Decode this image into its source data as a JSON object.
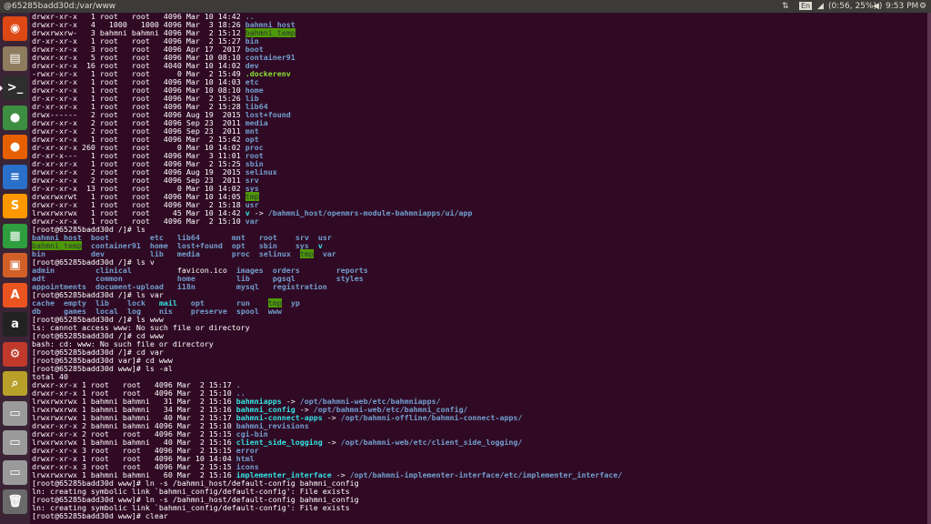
{
  "topbar": {
    "title": "@65285badd30d:/var/www",
    "kb": "En",
    "battery": "(0:56, 25%)",
    "time": "9:53 PM"
  },
  "launcher": [
    {
      "name": "ubuntu-dash-icon",
      "label": "◉",
      "color": "#dd4814"
    },
    {
      "name": "files-icon",
      "label": "▤",
      "color": "#8f7b5e"
    },
    {
      "name": "terminal-icon",
      "label": ">_",
      "color": "#2e2e2e",
      "active": true
    },
    {
      "name": "chrome-icon",
      "label": "●",
      "color": "#3e8e41"
    },
    {
      "name": "firefox-icon",
      "label": "●",
      "color": "#e66000"
    },
    {
      "name": "writer-icon",
      "label": "≡",
      "color": "#2a6fc9"
    },
    {
      "name": "sublime-icon",
      "label": "S",
      "color": "#ff9800"
    },
    {
      "name": "calc-icon",
      "label": "▦",
      "color": "#2e9e3e"
    },
    {
      "name": "impress-icon",
      "label": "▣",
      "color": "#d35f28"
    },
    {
      "name": "software-center-icon",
      "label": "A",
      "color": "#e95420"
    },
    {
      "name": "amazon-icon",
      "label": "a",
      "color": "#222222"
    },
    {
      "name": "settings-icon",
      "label": "⚙",
      "color": "#c0392b"
    },
    {
      "name": "image-viewer-icon",
      "label": "⌕",
      "color": "#b8a02a"
    },
    {
      "name": "drive-1-icon",
      "label": "▭",
      "color": "#9a9a9a"
    },
    {
      "name": "drive-2-icon",
      "label": "▭",
      "color": "#9a9a9a"
    },
    {
      "name": "drive-3-icon",
      "label": "▭",
      "color": "#9a9a9a"
    },
    {
      "name": "trash-icon",
      "label": "🗑",
      "color": "#6a6a6a"
    }
  ],
  "colors": {
    "terminal_bg": "#300a24",
    "dir": "#729fcf",
    "link": "#34e2e2",
    "exec": "#8ae234",
    "sticky_bg": "#4e9a06"
  },
  "lines": [
    [
      [
        "drwxr-xr-x   1 root   root   4096 Mar 10 14:42 "
      ],
      [
        "..",
        "d"
      ]
    ],
    [
      [
        "drwxr-xr-x   4   1000   1000 4096 Mar  3 18:26 "
      ],
      [
        "bahmni_host",
        "d"
      ]
    ],
    [
      [
        "drwxrwxrw-   3 bahmni bahmni 4096 Mar  2 15:12 "
      ],
      [
        "bahmni_temp",
        "hl"
      ]
    ],
    [
      [
        "dr-xr-xr-x   1 root   root   4096 Mar  2 15:27 "
      ],
      [
        "bin",
        "d"
      ]
    ],
    [
      [
        "drwxr-xr-x   3 root   root   4096 Apr 17  2017 "
      ],
      [
        "boot",
        "d"
      ]
    ],
    [
      [
        "drwxr-xr-x   5 root   root   4096 Mar 10 08:10 "
      ],
      [
        "container91",
        "d"
      ]
    ],
    [
      [
        "drwxr-xr-x  16 root   root   4040 Mar 10 14:02 "
      ],
      [
        "dev",
        "d"
      ]
    ],
    [
      [
        "-rwxr-xr-x   1 root   root      0 Mar  2 15:49 "
      ],
      [
        ".dockerenv",
        "g"
      ]
    ],
    [
      [
        "drwxr-xr-x   1 root   root   4096 Mar 10 14:03 "
      ],
      [
        "etc",
        "d"
      ]
    ],
    [
      [
        "drwxr-xr-x   1 root   root   4096 Mar 10 08:10 "
      ],
      [
        "home",
        "d"
      ]
    ],
    [
      [
        "dr-xr-xr-x   1 root   root   4096 Mar  2 15:26 "
      ],
      [
        "lib",
        "d"
      ]
    ],
    [
      [
        "dr-xr-xr-x   1 root   root   4096 Mar  2 15:28 "
      ],
      [
        "lib64",
        "d"
      ]
    ],
    [
      [
        "drwx------   2 root   root   4096 Aug 19  2015 "
      ],
      [
        "lost+found",
        "d"
      ]
    ],
    [
      [
        "drwxr-xr-x   2 root   root   4096 Sep 23  2011 "
      ],
      [
        "media",
        "d"
      ]
    ],
    [
      [
        "drwxr-xr-x   2 root   root   4096 Sep 23  2011 "
      ],
      [
        "mnt",
        "d"
      ]
    ],
    [
      [
        "drwxr-xr-x   1 root   root   4096 Mar  2 15:42 "
      ],
      [
        "opt",
        "d"
      ]
    ],
    [
      [
        "dr-xr-xr-x 260 root   root      0 Mar 10 14:02 "
      ],
      [
        "proc",
        "d"
      ]
    ],
    [
      [
        "dr-xr-x---   1 root   root   4096 Mar  3 11:01 "
      ],
      [
        "root",
        "d"
      ]
    ],
    [
      [
        "dr-xr-xr-x   1 root   root   4096 Mar  2 15:25 "
      ],
      [
        "sbin",
        "d"
      ]
    ],
    [
      [
        "drwxr-xr-x   2 root   root   4096 Aug 19  2015 "
      ],
      [
        "selinux",
        "d"
      ]
    ],
    [
      [
        "drwxr-xr-x   2 root   root   4096 Sep 23  2011 "
      ],
      [
        "srv",
        "d"
      ]
    ],
    [
      [
        "dr-xr-xr-x  13 root   root      0 Mar 10 14:02 "
      ],
      [
        "sys",
        "d"
      ]
    ],
    [
      [
        "drwxrwxrwt   1 root   root   4096 Mar 10 14:05 "
      ],
      [
        "tmp",
        "hl"
      ]
    ],
    [
      [
        "drwxr-xr-x   1 root   root   4096 Mar  2 15:18 "
      ],
      [
        "usr",
        "d"
      ]
    ],
    [
      [
        "lrwxrwxrwx   1 root   root     45 Mar 10 14:42 "
      ],
      [
        "v",
        "c"
      ],
      [
        " -> "
      ],
      [
        "/bahmni_host/openmrs-module-bahmniapps/ui/app",
        "d"
      ]
    ],
    [
      [
        "drwxr-xr-x   1 root   root   4096 Mar  2 15:10 "
      ],
      [
        "var",
        "d"
      ]
    ],
    [
      [
        "[root@65285badd30d /]# ls"
      ]
    ],
    [
      [
        "bahmni_host",
        "d"
      ],
      [
        "  "
      ],
      [
        "boot",
        "d"
      ],
      [
        "         "
      ],
      [
        "etc",
        "d"
      ],
      [
        "   "
      ],
      [
        "lib64",
        "d"
      ],
      [
        "       "
      ],
      [
        "mnt",
        "d"
      ],
      [
        "   "
      ],
      [
        "root",
        "d"
      ],
      [
        "    "
      ],
      [
        "srv",
        "d"
      ],
      [
        "  "
      ],
      [
        "usr",
        "d"
      ]
    ],
    [
      [
        "bahmni_temp",
        "hl"
      ],
      [
        "  "
      ],
      [
        "container91",
        "d"
      ],
      [
        "  "
      ],
      [
        "home",
        "d"
      ],
      [
        "  "
      ],
      [
        "lost+found",
        "d"
      ],
      [
        "  "
      ],
      [
        "opt",
        "d"
      ],
      [
        "   "
      ],
      [
        "sbin",
        "d"
      ],
      [
        "    "
      ],
      [
        "sys",
        "d"
      ],
      [
        "  "
      ],
      [
        "v",
        "c"
      ]
    ],
    [
      [
        "bin",
        "d"
      ],
      [
        "          "
      ],
      [
        "dev",
        "d"
      ],
      [
        "          "
      ],
      [
        "lib",
        "d"
      ],
      [
        "   "
      ],
      [
        "media",
        "d"
      ],
      [
        "       "
      ],
      [
        "proc",
        "d"
      ],
      [
        "  "
      ],
      [
        "selinux",
        "d"
      ],
      [
        "  "
      ],
      [
        "tmp",
        "hl"
      ],
      [
        "  "
      ],
      [
        "var",
        "d"
      ]
    ],
    [
      [
        "[root@65285badd30d /]# ls v"
      ]
    ],
    [
      [
        "admin",
        "d"
      ],
      [
        "         "
      ],
      [
        "clinical",
        "d"
      ],
      [
        "          "
      ],
      [
        "favicon.ico"
      ],
      [
        "  "
      ],
      [
        "images",
        "d"
      ],
      [
        "  "
      ],
      [
        "orders",
        "d"
      ],
      [
        "        "
      ],
      [
        "reports",
        "d"
      ]
    ],
    [
      [
        "adt",
        "d"
      ],
      [
        "           "
      ],
      [
        "common",
        "d"
      ],
      [
        "            "
      ],
      [
        "home",
        "d"
      ],
      [
        "         "
      ],
      [
        "lib",
        "d"
      ],
      [
        "     "
      ],
      [
        "pgsql",
        "d"
      ],
      [
        "         "
      ],
      [
        "styles",
        "d"
      ]
    ],
    [
      [
        "appointments",
        "d"
      ],
      [
        "  "
      ],
      [
        "document-upload",
        "d"
      ],
      [
        "   "
      ],
      [
        "i18n",
        "d"
      ],
      [
        "         "
      ],
      [
        "mysql",
        "d"
      ],
      [
        "   "
      ],
      [
        "registration",
        "d"
      ]
    ],
    [
      [
        "[root@65285badd30d /]# ls var"
      ]
    ],
    [
      [
        "cache",
        "d"
      ],
      [
        "  "
      ],
      [
        "empty",
        "d"
      ],
      [
        "  "
      ],
      [
        "lib",
        "d"
      ],
      [
        "    "
      ],
      [
        "lock",
        "d"
      ],
      [
        "   "
      ],
      [
        "mail",
        "c"
      ],
      [
        "   "
      ],
      [
        "opt",
        "d"
      ],
      [
        "       "
      ],
      [
        "run",
        "d"
      ],
      [
        "    "
      ],
      [
        "tmp",
        "hl"
      ],
      [
        "  "
      ],
      [
        "yp",
        "d"
      ]
    ],
    [
      [
        "db",
        "d"
      ],
      [
        "     "
      ],
      [
        "games",
        "d"
      ],
      [
        "  "
      ],
      [
        "local",
        "d"
      ],
      [
        "  "
      ],
      [
        "log",
        "d"
      ],
      [
        "    "
      ],
      [
        "nis",
        "d"
      ],
      [
        "    "
      ],
      [
        "preserve",
        "d"
      ],
      [
        "  "
      ],
      [
        "spool",
        "d"
      ],
      [
        "  "
      ],
      [
        "www",
        "d"
      ]
    ],
    [
      [
        "[root@65285badd30d /]# ls www"
      ]
    ],
    [
      [
        "ls: cannot access www: No such file or directory"
      ]
    ],
    [
      [
        "[root@65285badd30d /]# cd www"
      ]
    ],
    [
      [
        "bash: cd: www: No such file or directory"
      ]
    ],
    [
      [
        "[root@65285badd30d /]# cd var"
      ]
    ],
    [
      [
        "[root@65285badd30d var]# cd www"
      ]
    ],
    [
      [
        "[root@65285badd30d www]# ls -al"
      ]
    ],
    [
      [
        "total 40"
      ]
    ],
    [
      [
        "drwxr-xr-x 1 root   root   4096 Mar  2 15:17 "
      ],
      [
        ".",
        "d"
      ]
    ],
    [
      [
        "drwxr-xr-x 1 root   root   4096 Mar  2 15:10 "
      ],
      [
        "..",
        "d"
      ]
    ],
    [
      [
        "lrwxrwxrwx 1 bahmni bahmni   31 Mar  2 15:16 "
      ],
      [
        "bahmniapps",
        "c"
      ],
      [
        " -> "
      ],
      [
        "/opt/bahmni-web/etc/bahmniapps/",
        "d"
      ]
    ],
    [
      [
        "lrwxrwxrwx 1 bahmni bahmni   34 Mar  2 15:16 "
      ],
      [
        "bahmni_config",
        "c"
      ],
      [
        " -> "
      ],
      [
        "/opt/bahmni-web/etc/bahmni_config/",
        "d"
      ]
    ],
    [
      [
        "lrwxrwxrwx 1 bahmni bahmni   40 Mar  2 15:17 "
      ],
      [
        "bahmni-connect-apps",
        "c"
      ],
      [
        " -> "
      ],
      [
        "/opt/bahmni-offline/bahmni-connect-apps/",
        "d"
      ]
    ],
    [
      [
        "drwxr-xr-x 2 bahmni bahmni 4096 Mar  2 15:10 "
      ],
      [
        "bahmni_revisions",
        "d"
      ]
    ],
    [
      [
        "drwxr-xr-x 2 root   root   4096 Mar  2 15:15 "
      ],
      [
        "cgi-bin",
        "d"
      ]
    ],
    [
      [
        "lrwxrwxrwx 1 bahmni bahmni   40 Mar  2 15:16 "
      ],
      [
        "client_side_logging",
        "c"
      ],
      [
        " -> "
      ],
      [
        "/opt/bahmni-web/etc/client_side_logging/",
        "d"
      ]
    ],
    [
      [
        "drwxr-xr-x 3 root   root   4096 Mar  2 15:15 "
      ],
      [
        "error",
        "d"
      ]
    ],
    [
      [
        "drwxr-xr-x 1 root   root   4096 Mar 10 14:04 "
      ],
      [
        "html",
        "d"
      ]
    ],
    [
      [
        "drwxr-xr-x 3 root   root   4096 Mar  2 15:15 "
      ],
      [
        "icons",
        "d"
      ]
    ],
    [
      [
        "lrwxrwxrwx 1 bahmni bahmni   60 Mar  2 15:16 "
      ],
      [
        "implementer_interface",
        "c"
      ],
      [
        " -> "
      ],
      [
        "/opt/bahmni-implementer-interface/etc/implementer_interface/",
        "d"
      ]
    ],
    [
      [
        "[root@65285badd30d www]# ln -s /bahmni_host/default-config bahmni_config"
      ]
    ],
    [
      [
        "ln: creating symbolic link `bahmni_config/default-config': File exists"
      ]
    ],
    [
      [
        "[root@65285badd30d www]# ln -s /bahmni_host/default-config bahmni_config"
      ]
    ],
    [
      [
        "ln: creating symbolic link `bahmni_config/default-config': File exists"
      ]
    ],
    [
      [
        "[root@65285badd30d www]# clear"
      ]
    ]
  ]
}
